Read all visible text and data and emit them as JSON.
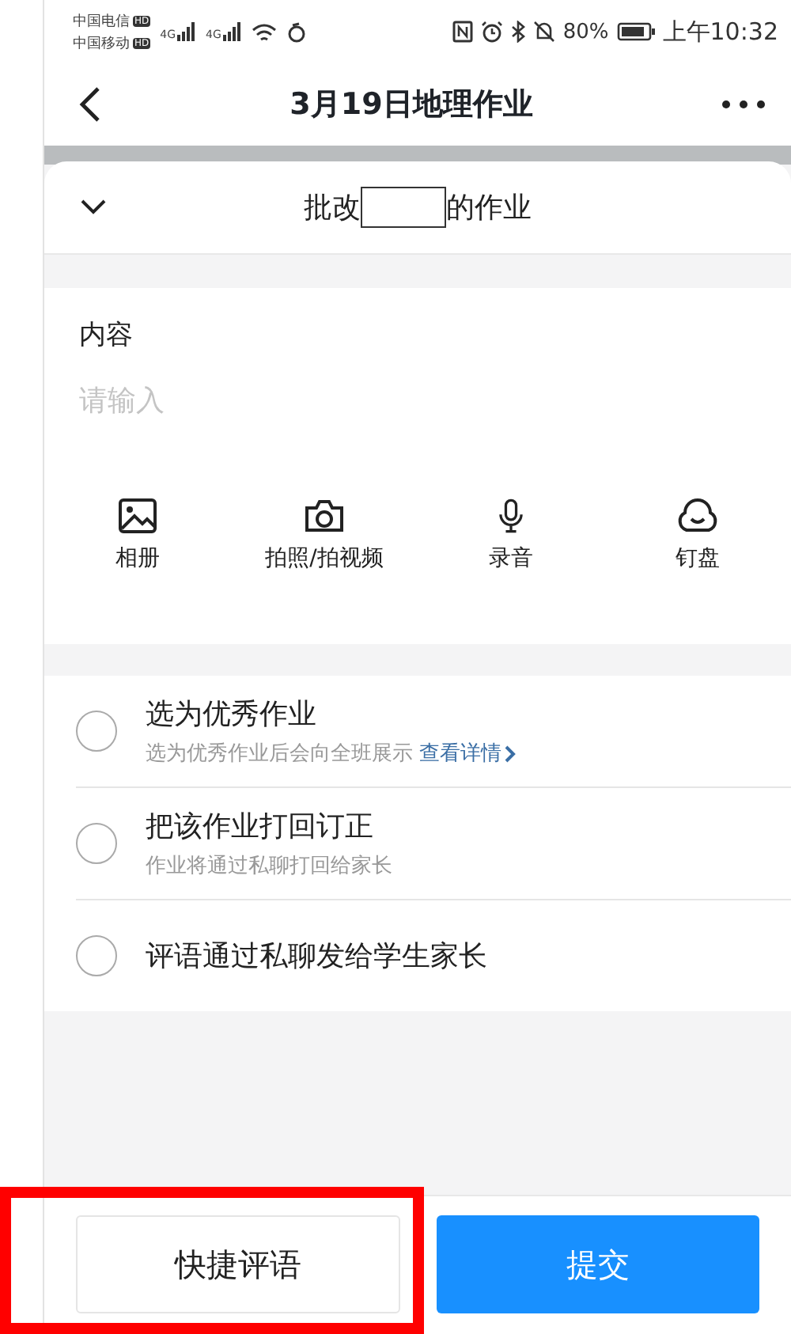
{
  "status_bar": {
    "carriers": [
      {
        "name": "中国电信",
        "badge": "HD"
      },
      {
        "name": "中国移动",
        "badge": "HD"
      }
    ],
    "signals": [
      "4G",
      "4G"
    ],
    "battery": "80%",
    "time": "上午10:32"
  },
  "header": {
    "title": "3月19日地理作业"
  },
  "sheet": {
    "title_before": "批改",
    "title_after": "的作业",
    "expanded": true
  },
  "content": {
    "label": "内容",
    "placeholder": "请输入"
  },
  "attachments": [
    {
      "kind": "album",
      "label": "相册"
    },
    {
      "kind": "camera",
      "label": "拍照/拍视频"
    },
    {
      "kind": "mic",
      "label": "录音"
    },
    {
      "kind": "cloud",
      "label": "钉盘"
    }
  ],
  "options": [
    {
      "title": "选为优秀作业",
      "hint": "选为优秀作业后会向全班展示",
      "link": "查看详情",
      "selected": false
    },
    {
      "title": "把该作业打回订正",
      "hint": "作业将通过私聊打回给家长",
      "selected": false
    },
    {
      "title": "评语通过私聊发给学生家长",
      "selected": false
    }
  ],
  "footer": {
    "quick_comment": "快捷评语",
    "submit": "提交",
    "highlighted": true
  }
}
